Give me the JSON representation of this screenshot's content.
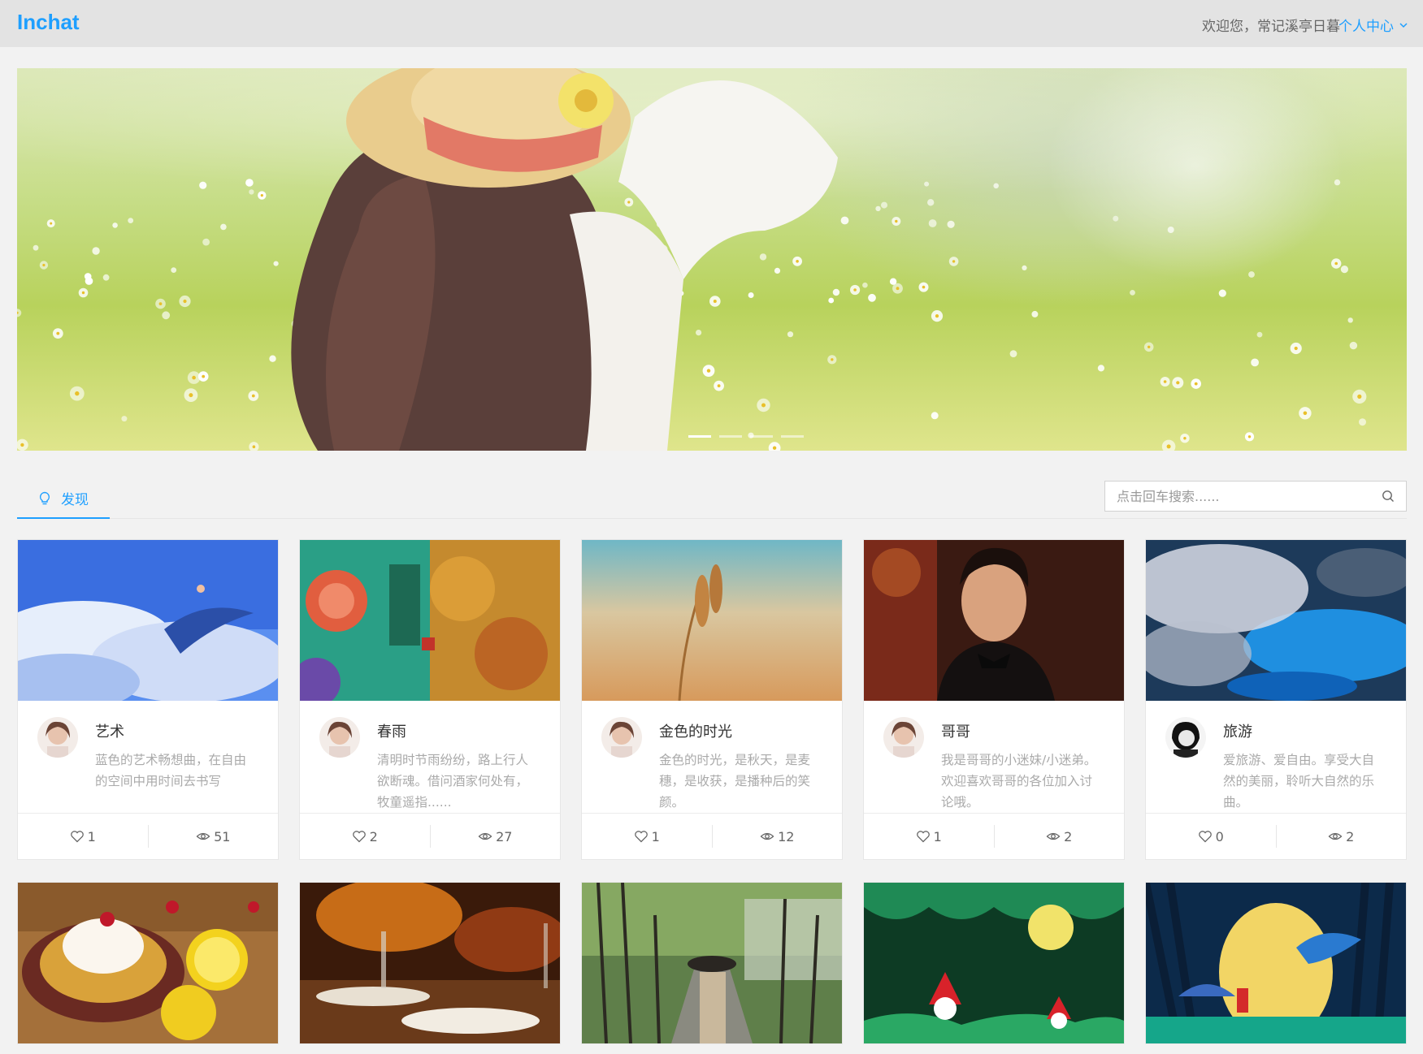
{
  "header": {
    "brand": "Inchat",
    "welcome": "欢迎您，常记溪亭日暮",
    "user_center": "个人中心"
  },
  "banner": {
    "slide_count": 4,
    "active_slide": 0
  },
  "tabs": [
    {
      "label": "发现",
      "icon": "bulb-icon"
    }
  ],
  "search": {
    "placeholder": "点击回车搜索......"
  },
  "cards": [
    {
      "title": "艺术",
      "desc": "蓝色的艺术畅想曲，在自由的空间中用时间去书写",
      "likes": "1",
      "views": "51"
    },
    {
      "title": "春雨",
      "desc": "清明时节雨纷纷，路上行人欲断魂。借问酒家何处有，牧童遥指......",
      "likes": "2",
      "views": "27"
    },
    {
      "title": "金色的时光",
      "desc": "金色的时光，是秋天，是麦穗，是收获，是播种后的笑颜。",
      "likes": "1",
      "views": "12"
    },
    {
      "title": "哥哥",
      "desc": "我是哥哥的小迷妹/小迷弟。欢迎喜欢哥哥的各位加入讨论哦。",
      "likes": "1",
      "views": "2"
    },
    {
      "title": "旅游",
      "desc": "爱旅游、爱自由。享受大自然的美丽，聆听大自然的乐曲。",
      "likes": "0",
      "views": "2"
    }
  ],
  "colors": {
    "accent": "#1e9fff",
    "topbar": "#e3e3e3",
    "page_bg": "#f2f2f2"
  }
}
